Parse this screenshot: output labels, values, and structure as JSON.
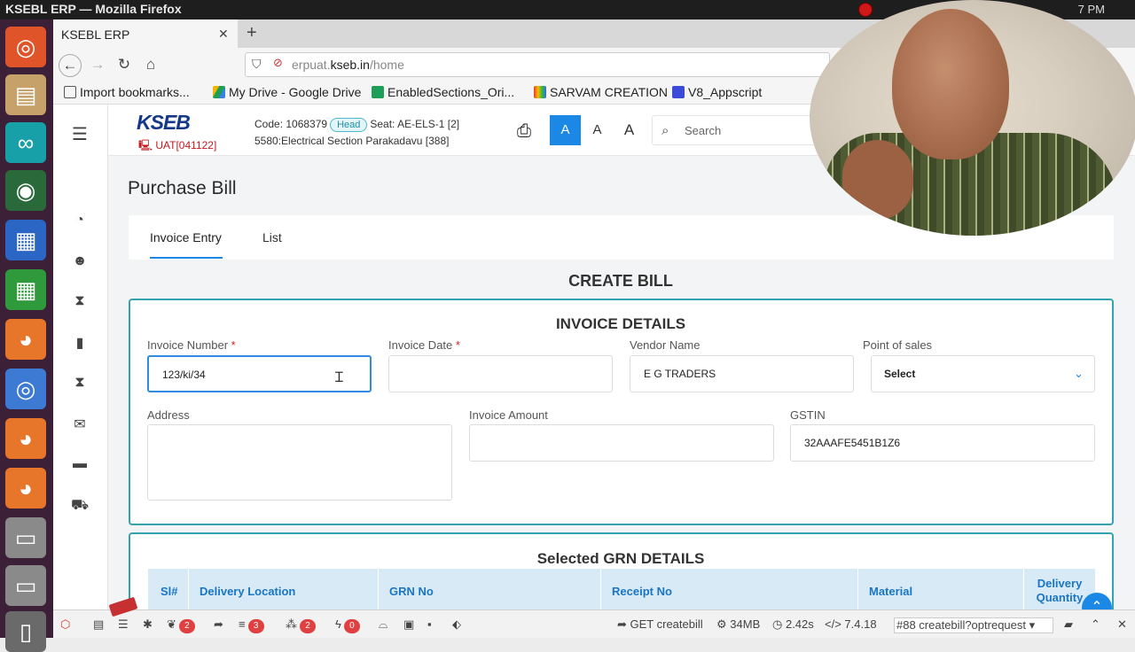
{
  "os": {
    "window_title": "KSEBL ERP — Mozilla Firefox",
    "clock": "7 PM"
  },
  "browser": {
    "tab_title": "KSEBL ERP",
    "url_prefix": "erpuat.",
    "url_host": "kseb.in",
    "url_path": "/home",
    "bookmarks": [
      "Import bookmarks...",
      "My Drive - Google Drive",
      "EnabledSections_Ori...",
      "SARVAM CREATION",
      "V8_Appscript"
    ]
  },
  "header": {
    "logo": "KSEB",
    "env": "UAT[041122]",
    "code_label": "Code: 1068379",
    "head_badge": "Head",
    "seat": "Seat: AE-ELS-1 [2]",
    "section": "5580:Electrical Section Parakadavu [388]",
    "font_buttons": [
      "A",
      "A",
      "A"
    ],
    "search_placeholder": "Search"
  },
  "page": {
    "title": "Purchase Bill",
    "tabs": [
      "Invoice Entry",
      "List"
    ],
    "create_title": "CREATE BILL"
  },
  "invoice": {
    "section_title": "INVOICE DETAILS",
    "invoice_number_label": "Invoice Number",
    "invoice_number_value": "123/ki/34",
    "invoice_date_label": "Invoice Date",
    "invoice_date_value": "",
    "vendor_label": "Vendor Name",
    "vendor_value": "E G TRADERS",
    "pos_label": "Point of sales",
    "pos_value": "Select",
    "address_label": "Address",
    "address_value": "",
    "amount_label": "Invoice Amount",
    "amount_value": "",
    "gstin_label": "GSTIN",
    "gstin_value": "32AAAFE5451B1Z6",
    "required_mark": "*"
  },
  "grn": {
    "section_title": "Selected GRN DETAILS",
    "columns": [
      "Sl#",
      "Delivery Location",
      "GRN No",
      "Receipt No",
      "Material",
      "Delivery Quantity"
    ]
  },
  "debugbar": {
    "badges": [
      "2",
      "3",
      "2",
      "0"
    ],
    "request": "GET createbill",
    "memory": "34MB",
    "time": "2.42s",
    "php_version": "7.4.18",
    "route": "#88 createbill?optrequest"
  }
}
